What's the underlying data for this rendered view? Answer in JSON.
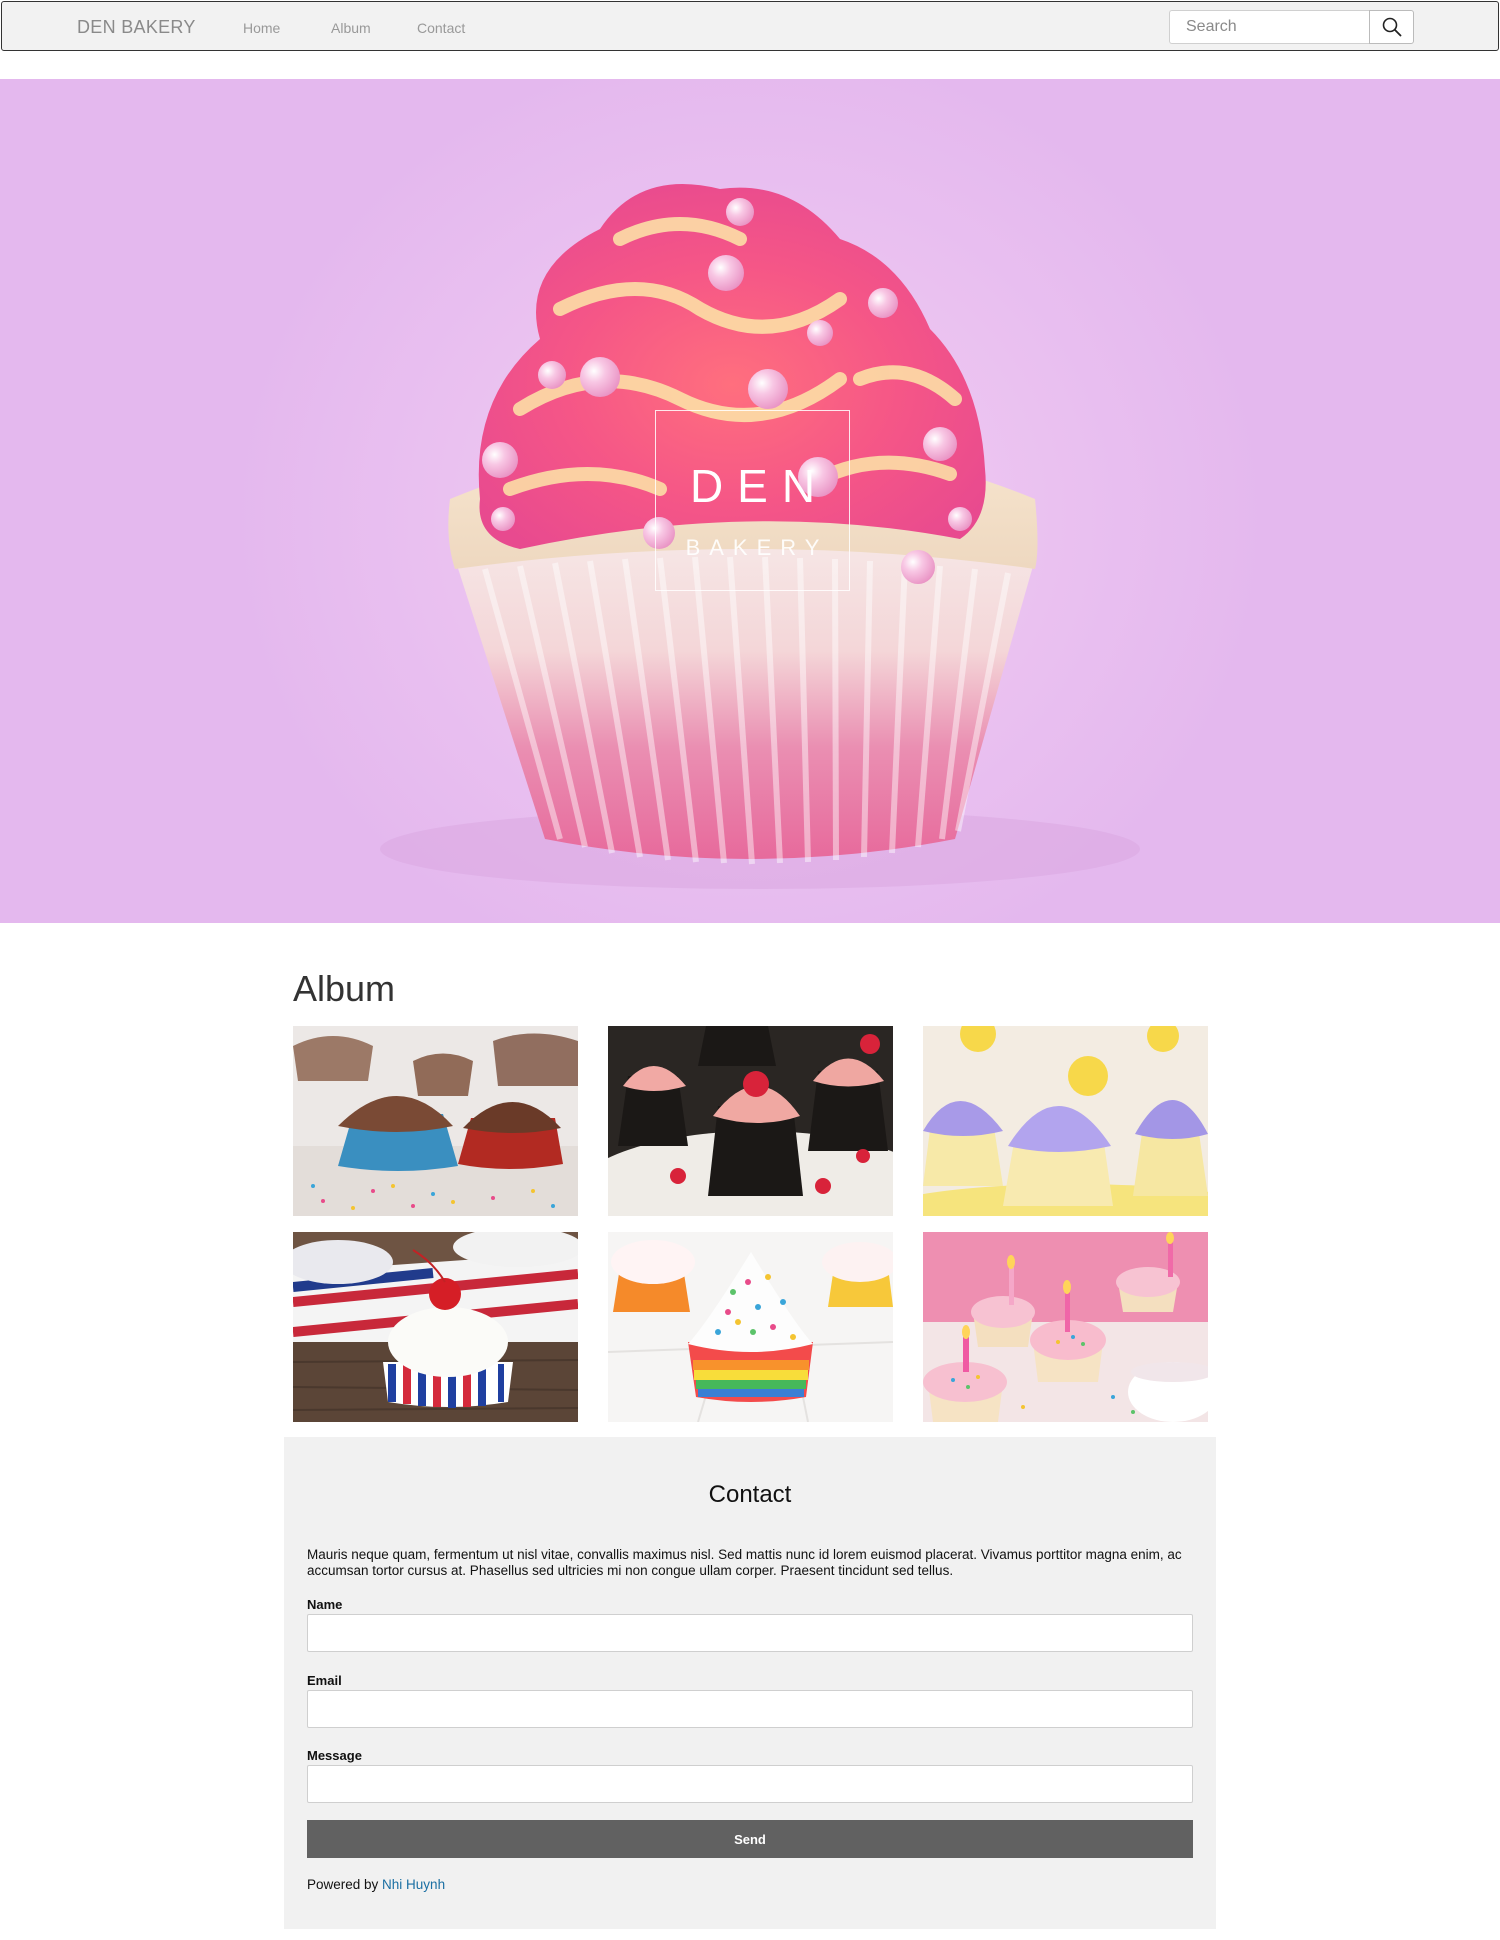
{
  "navbar": {
    "brand": "DEN BAKERY",
    "links": [
      {
        "label": "Home"
      },
      {
        "label": "Album"
      },
      {
        "label": "Contact"
      }
    ],
    "search": {
      "placeholder": "Search",
      "icon": "search-icon"
    }
  },
  "hero": {
    "title": "DEN",
    "subtitle": "BAKERY",
    "background_color": "#ecc4f1"
  },
  "album": {
    "title": "Album",
    "photos": [
      {
        "subject": "chocolate-sprinkle-cupcakes"
      },
      {
        "subject": "raspberry-chocolate-cupcakes"
      },
      {
        "subject": "lavender-lemon-cupcakes"
      },
      {
        "subject": "patriotic-cherry-cupcake"
      },
      {
        "subject": "rainbow-sprinkle-cupcake"
      },
      {
        "subject": "birthday-candle-cupcakes"
      }
    ]
  },
  "contact": {
    "title": "Contact",
    "text": "Mauris neque quam, fermentum ut nisl vitae, convallis maximus nisl. Sed mattis nunc id lorem euismod placerat. Vivamus porttitor magna enim, ac accumsan tortor cursus at. Phasellus sed ultricies mi non congue ullam corper. Praesent tincidunt sed tellus.",
    "fields": {
      "name_label": "Name",
      "email_label": "Email",
      "message_label": "Message",
      "name_value": "",
      "email_value": "",
      "message_value": ""
    },
    "send_label": "Send",
    "powered_prefix": "Powered by ",
    "powered_link": "Nhi Huynh",
    "link_color": "#1a6fa3",
    "button_color": "#616161"
  }
}
